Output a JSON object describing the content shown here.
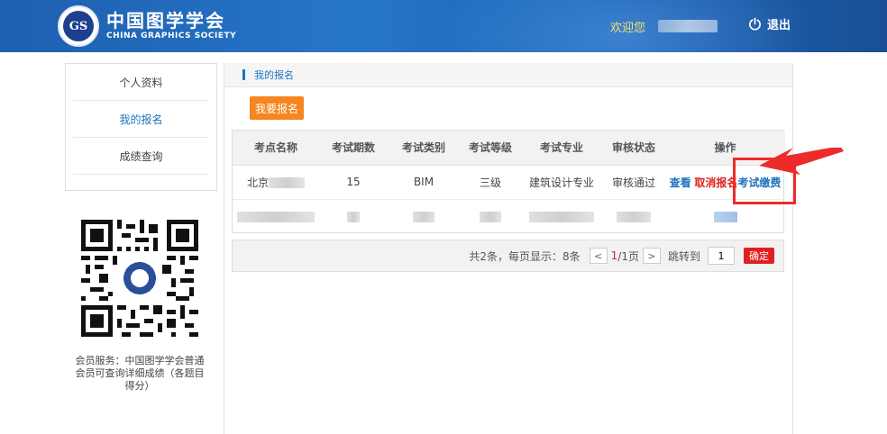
{
  "header": {
    "logo_cn": "中国图学学会",
    "logo_en": "CHINA GRAPHICS SOCIETY",
    "logo_mark": "GS",
    "welcome": "欢迎您",
    "logout": "退出",
    "colors": {
      "accent": "#1e73be",
      "welcome": "#f3e070"
    }
  },
  "sidebar": {
    "items": [
      {
        "label": "个人资料",
        "active": false
      },
      {
        "label": "我的报名",
        "active": true
      },
      {
        "label": "成绩查询",
        "active": false
      }
    ],
    "member_note": "会员服务：中国图学学会普通会员可查询详细成绩（各题目得分）"
  },
  "main": {
    "breadcrumb": "我的报名",
    "apply_button": "我要报名",
    "table": {
      "headers": [
        "考点名称",
        "考试期数",
        "考试类别",
        "考试等级",
        "考试专业",
        "审核状态",
        "操作"
      ],
      "rows": [
        {
          "site": "北京",
          "period": "15",
          "category": "BIM",
          "level": "三级",
          "major": "建筑设计专业",
          "status": "审核通过",
          "ops": {
            "view": "查看",
            "cancel": "取消报名",
            "pay": "考试缴费"
          }
        }
      ]
    },
    "pager": {
      "summary": "共2条，每页显示：8条",
      "prev": "<",
      "current": "1",
      "total": "/1页",
      "next": ">",
      "goto_label": "跳转到",
      "goto_value": "1",
      "confirm": "确定"
    }
  }
}
